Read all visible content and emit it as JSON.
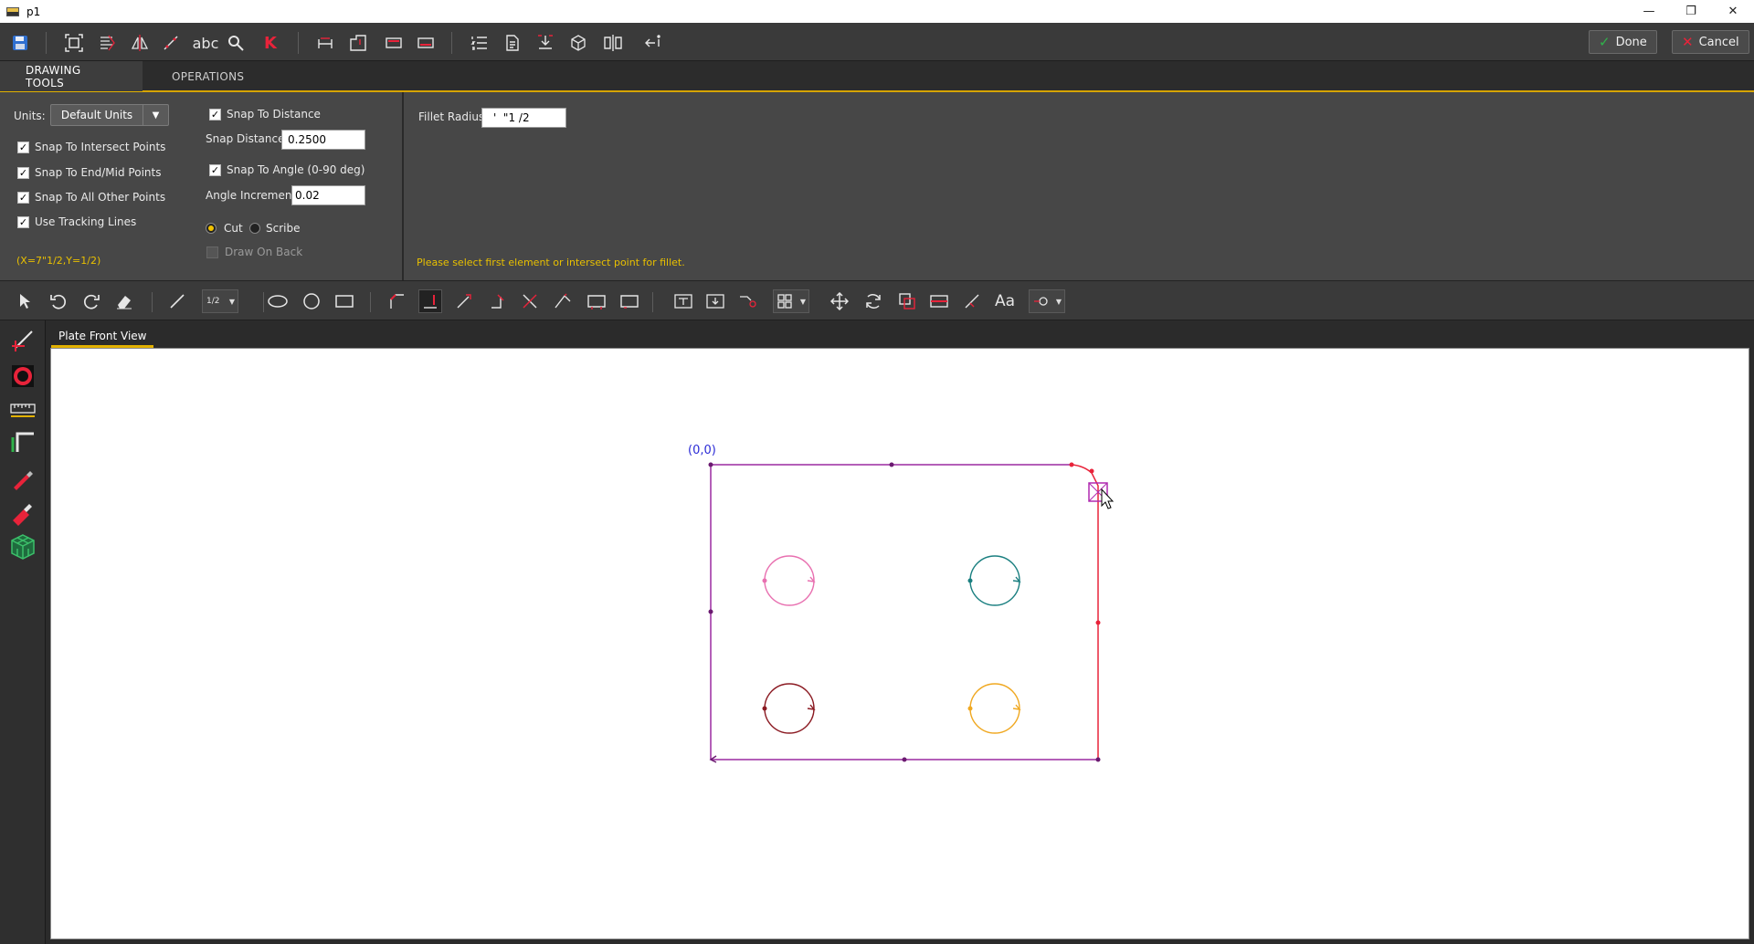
{
  "window": {
    "title": "p1",
    "controls": [
      "—",
      "❐",
      "✕"
    ]
  },
  "toolbar": {
    "done_label": "Done",
    "cancel_label": "Cancel",
    "abc": "abc",
    "k": "K"
  },
  "tabs": [
    {
      "label": "DRAWING TOOLS",
      "active": true
    },
    {
      "label": "OPERATIONS",
      "active": false
    }
  ],
  "options": {
    "units_label": "Units:",
    "units_value": "Default Units",
    "snap_intersect": "Snap To Intersect Points",
    "snap_endmid": "Snap To End/Mid Points",
    "snap_other": "Snap To All Other Points",
    "tracking_lines": "Use Tracking Lines",
    "coords": "(X=7\"1/2,Y=1/2)",
    "snap_distance_check": "Snap To Distance",
    "snap_distance_label": "Snap Distance:",
    "snap_distance_value": "0.2500",
    "snap_angle_check": "Snap To Angle (0-90 deg)",
    "angle_increment_label": "Angle Increment:",
    "angle_increment_value": "0.02",
    "cut_label": "Cut",
    "scribe_label": "Scribe",
    "draw_on_back": "Draw On Back",
    "fillet_radius_label": "Fillet Radius",
    "fillet_radius_value": "'  \"1 /2",
    "status_message": "Please select first element or intersect point for fillet."
  },
  "drawbar": {
    "aa_label": "Aa",
    "num_icon": "1/2"
  },
  "view": {
    "tab_label": "Plate Front View",
    "origin_label": "(0,0)"
  },
  "colors": {
    "accent": "#e2b100",
    "plate_outline": "#9b2aa0",
    "selected_edge": "#e8233a",
    "hole_pink": "#e870b0",
    "hole_teal": "#1a7f80",
    "hole_darkred": "#8b1a22",
    "hole_orange": "#f0a820"
  }
}
